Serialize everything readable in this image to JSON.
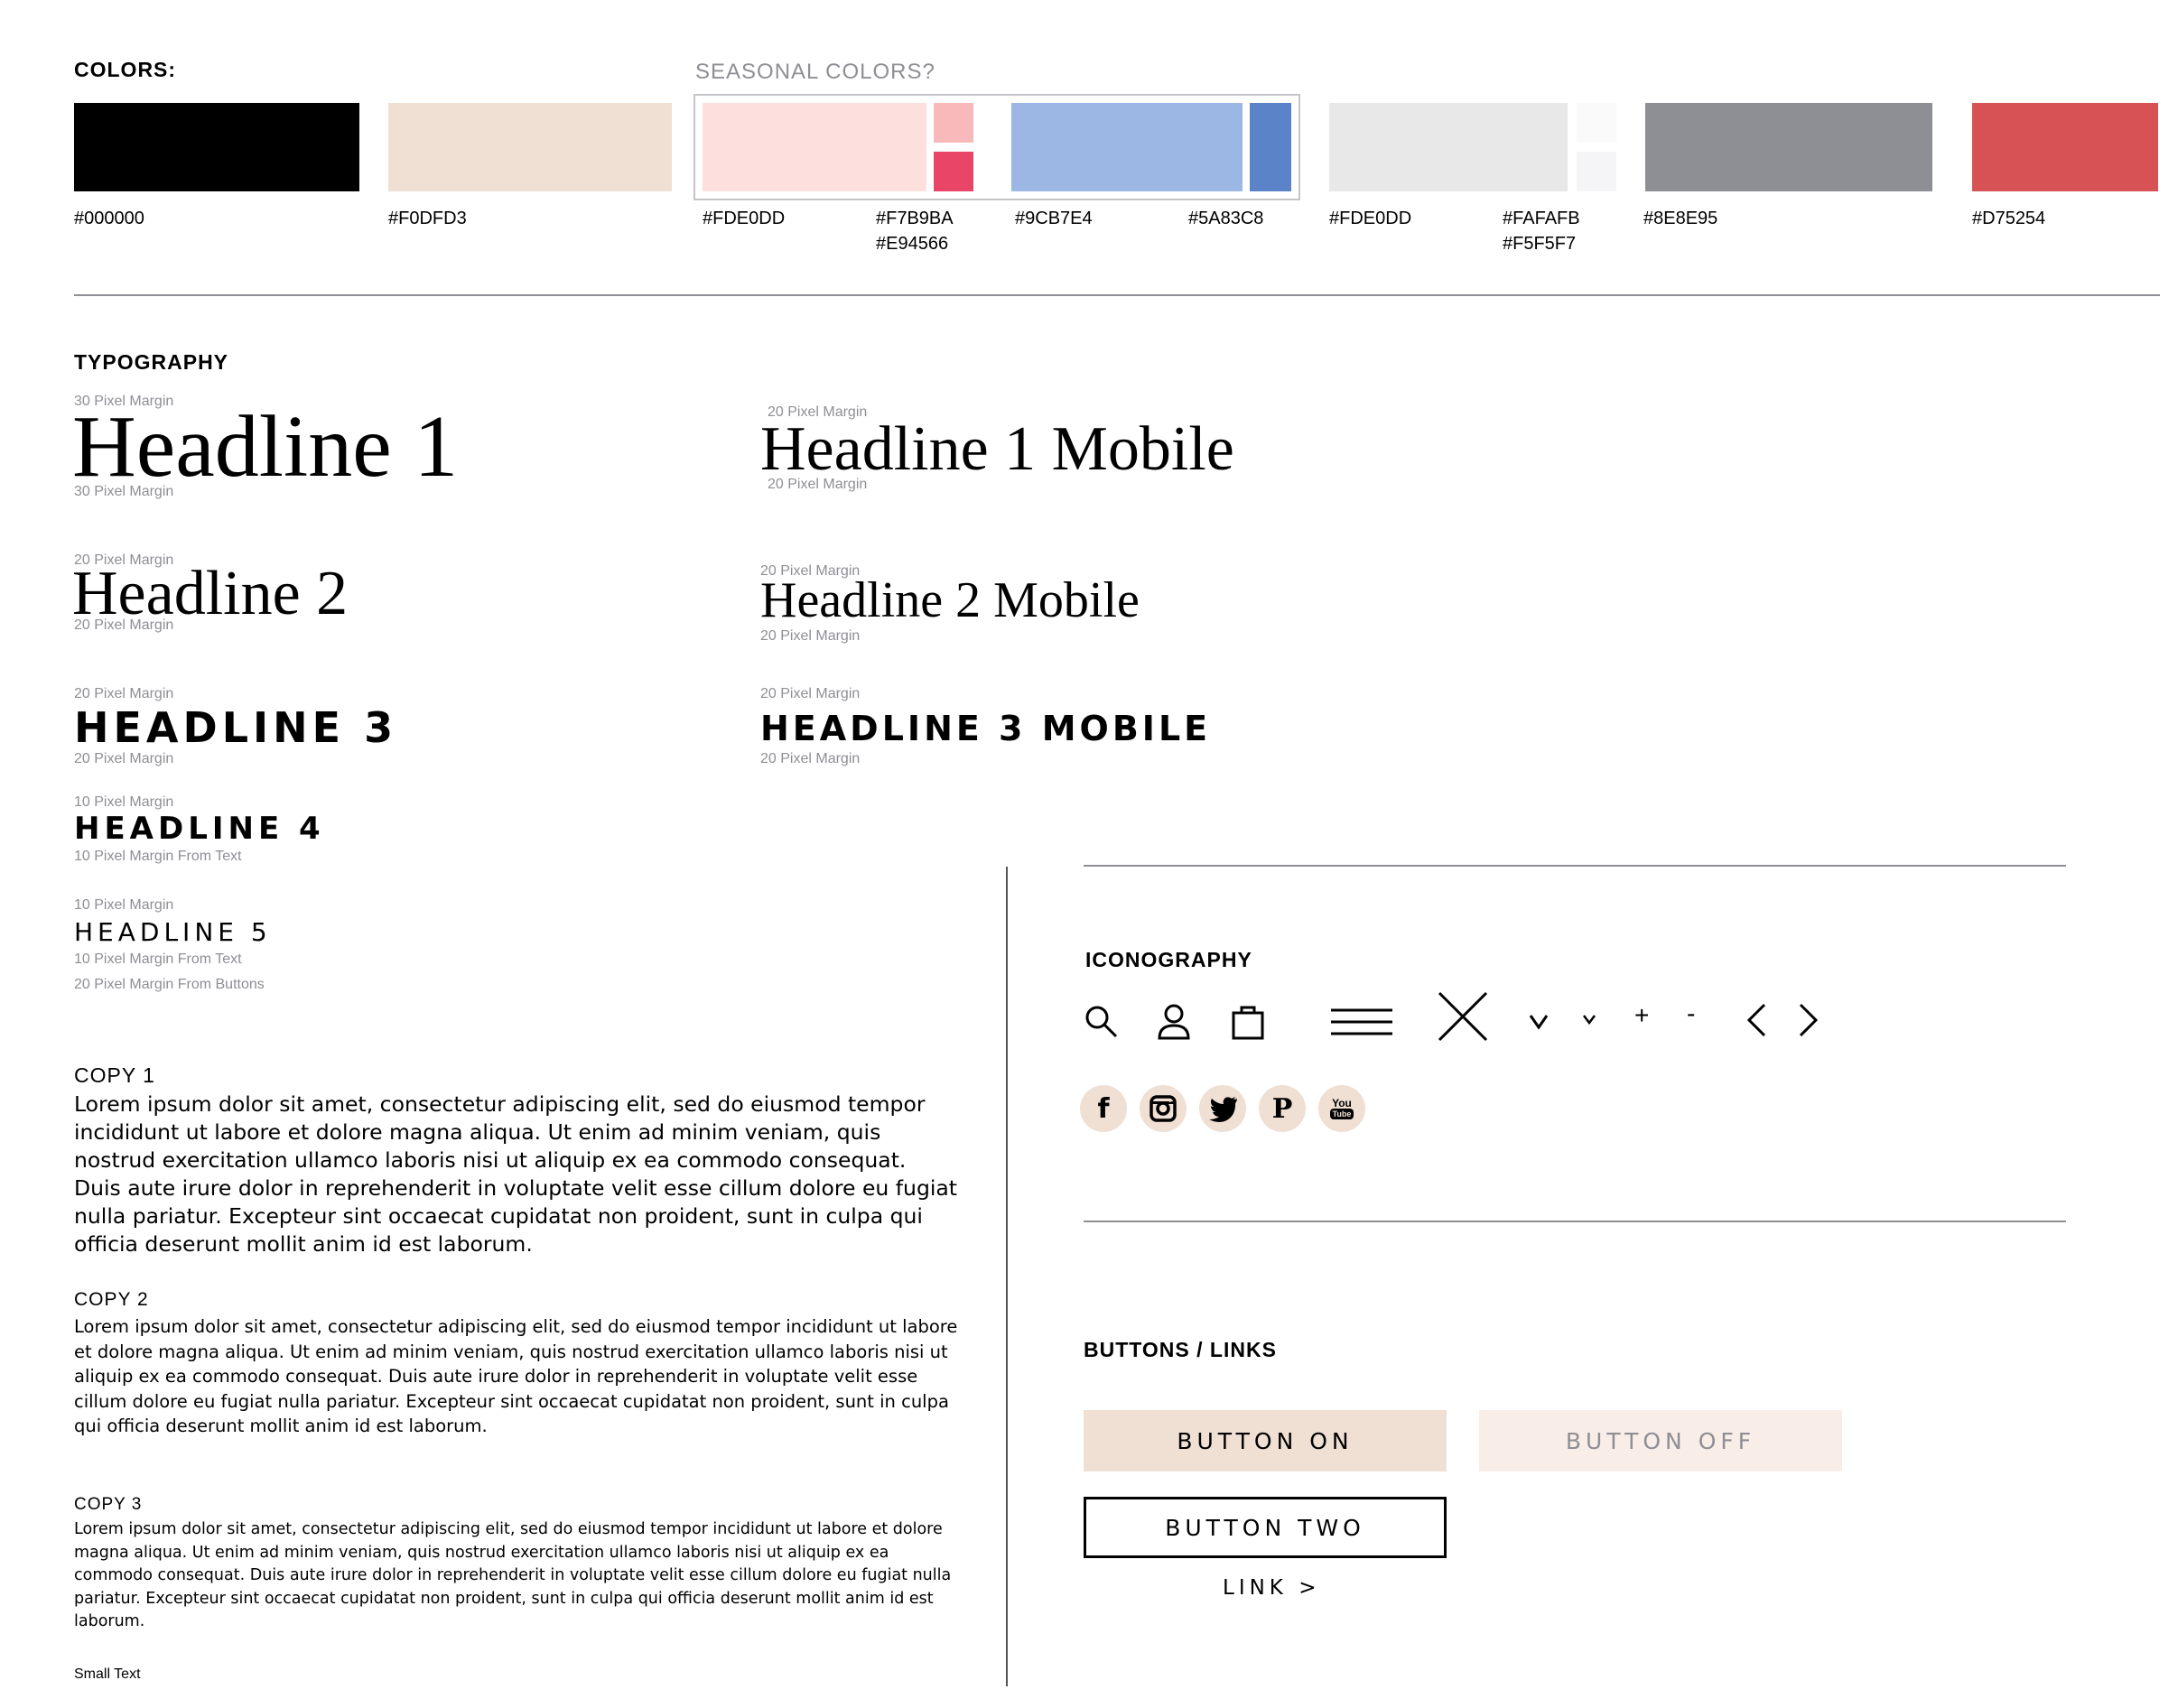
{
  "colors": {
    "title": "COLORS:",
    "seasonal_title": "SEASONAL COLORS?",
    "black": "#000000",
    "tan": "#F0DFD3",
    "pink_light": "#FDE0DD",
    "pink_mid": "#F7B9BA",
    "pink_dark": "#E94566",
    "blue_light": "#9CB7E4",
    "blue_dark": "#5A83C8",
    "gray_light": "#E8E8E9",
    "gray_lighter": "#FAFAFB",
    "gray_lightest": "#F5F5F7",
    "gray_dark": "#8E8E95",
    "red": "#D75254",
    "labels": {
      "black": "#000000",
      "tan": "#F0DFD3",
      "pink_light": "#FDE0DD",
      "pink_small": "#F7B9BA\n#E94566",
      "blue_light": "#9CB7E4",
      "blue_dark": "#5A83C8",
      "gray_light": "#FDE0DD",
      "gray_small": "#FAFAFB\n#F5F5F7",
      "gray_dark": "#8E8E95",
      "red": "#D75254"
    }
  },
  "typography": {
    "title": "TYPOGRAPHY",
    "notes": {
      "m30": "30 Pixel Margin",
      "m20": "20 Pixel Margin",
      "m10": "10 Pixel Margin",
      "m10_text": "10 Pixel Margin From Text",
      "m20_buttons": "20 Pixel Margin From Buttons"
    },
    "h1": "Headline 1",
    "h1_mobile": "Headline 1 Mobile",
    "h2": "Headline 2",
    "h2_mobile": "Headline 2 Mobile",
    "h3": "HEADLINE 3",
    "h3_mobile": "HEADLINE 3 MOBILE",
    "h4": "HEADLINE 4",
    "h5": "HEADLINE 5",
    "copy1_label": "COPY 1",
    "copy1": "Lorem ipsum dolor sit amet, consectetur adipiscing elit, sed do eiusmod tempor incididunt ut labore et dolore magna aliqua. Ut enim ad minim veniam, quis nostrud exercitation ullamco laboris nisi ut aliquip ex ea commodo consequat. Duis aute irure dolor in reprehenderit in voluptate velit esse cillum dolore eu fugiat nulla pariatur. Excepteur sint occaecat cupidatat non proident, sunt in culpa qui officia deserunt mollit anim id est laborum.",
    "copy2_label": "COPY 2",
    "copy2": "Lorem ipsum dolor sit amet, consectetur adipiscing elit, sed do eiusmod tempor incididunt ut labore et dolore magna aliqua. Ut enim ad minim veniam, quis nostrud exercitation ullamco laboris nisi ut aliquip ex ea commodo consequat. Duis aute irure dolor in reprehenderit in voluptate velit esse cillum dolore eu fugiat nulla pariatur. Excepteur sint occaecat cupidatat non proident, sunt in culpa qui officia deserunt mollit anim id est laborum.",
    "copy3_label": "COPY 3",
    "copy3": "Lorem ipsum dolor sit amet, consectetur adipiscing elit, sed do eiusmod tempor incididunt ut labore et dolore magna aliqua. Ut enim ad minim veniam, quis nostrud exercitation ullamco laboris nisi ut aliquip ex ea commodo consequat. Duis aute irure dolor in reprehenderit in voluptate velit esse cillum dolore eu fugiat nulla pariatur. Excepteur sint occaecat cupidatat non proident, sunt in culpa qui officia deserunt mollit anim id est laborum.",
    "small_text": "Small Text"
  },
  "iconography": {
    "title": "ICONOGRAPHY",
    "icons": [
      "search-icon",
      "user-icon",
      "bag-icon",
      "menu-icon",
      "close-icon",
      "chevron-down-icon",
      "chevron-down-small-icon",
      "plus-icon",
      "minus-icon",
      "chevron-left-icon",
      "chevron-right-icon"
    ],
    "social": [
      "facebook-icon",
      "instagram-icon",
      "twitter-icon",
      "pinterest-icon",
      "youtube-icon"
    ],
    "plus": "+",
    "minus": "-",
    "facebook": "f",
    "pinterest": "P",
    "youtube_top": "You",
    "youtube_bottom": "Tube"
  },
  "buttons": {
    "title": "BUTTONS / LINKS",
    "on": "BUTTON ON",
    "off": "BUTTON OFF",
    "two": "BUTTON TWO",
    "link": "LINK >"
  }
}
